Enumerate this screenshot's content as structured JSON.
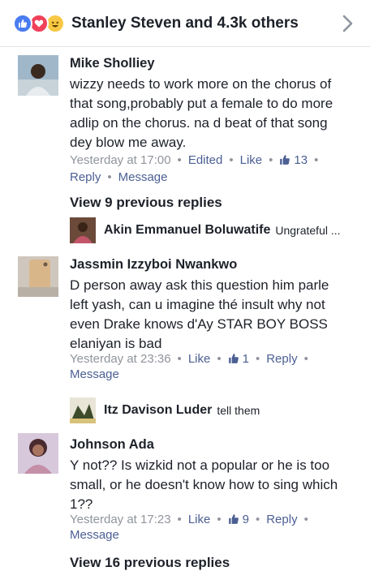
{
  "reactions": {
    "icons": [
      "like-icon",
      "love-icon",
      "haha-icon"
    ],
    "summary": "Stanley Steven and 4.3k others"
  },
  "comments": [
    {
      "author": "Mike Sholliey",
      "body": "wizzy needs to work more on the chorus of that song,probably put a female to do more adlip on the chorus. na d beat of that song dey blow me away.",
      "timestamp": "Yesterday at 17:00",
      "edited": "Edited",
      "like": "Like",
      "like_count": "13",
      "reply": "Reply",
      "message": "Message"
    },
    {
      "author": "Jassmin Izzyboi Nwankwo",
      "body": "D person away ask this question him parle left yash, can u imagine thé insult why not even Drake knows d'Ay STAR BOY BOSS elaniyan is bad",
      "timestamp": "Yesterday at 23:36",
      "like": "Like",
      "like_count": "1",
      "reply": "Reply",
      "message": "Message"
    },
    {
      "author": "Johnson Ada",
      "body": "Y not?? Is wizkid not a popular or he is too small, or he doesn't know how to sing which 1??",
      "timestamp": "Yesterday at 17:23",
      "like": "Like",
      "like_count": "9",
      "reply": "Reply",
      "message": "Message"
    }
  ],
  "threads": [
    {
      "view_previous": "View 9 previous replies",
      "reply_author": "Akin Emmanuel Boluwatife",
      "reply_text": "Ungrateful ..."
    },
    {
      "reply_author": "Itz Davison Luder",
      "reply_text": "tell them"
    },
    {
      "view_previous": "View 16 previous replies"
    }
  ],
  "colors": {
    "link": "#4b5f93",
    "meta": "#90949c",
    "text": "#1d2129",
    "like_blue": "#4a7cf0",
    "love_red": "#f0405a",
    "haha_yellow": "#f7c844"
  }
}
